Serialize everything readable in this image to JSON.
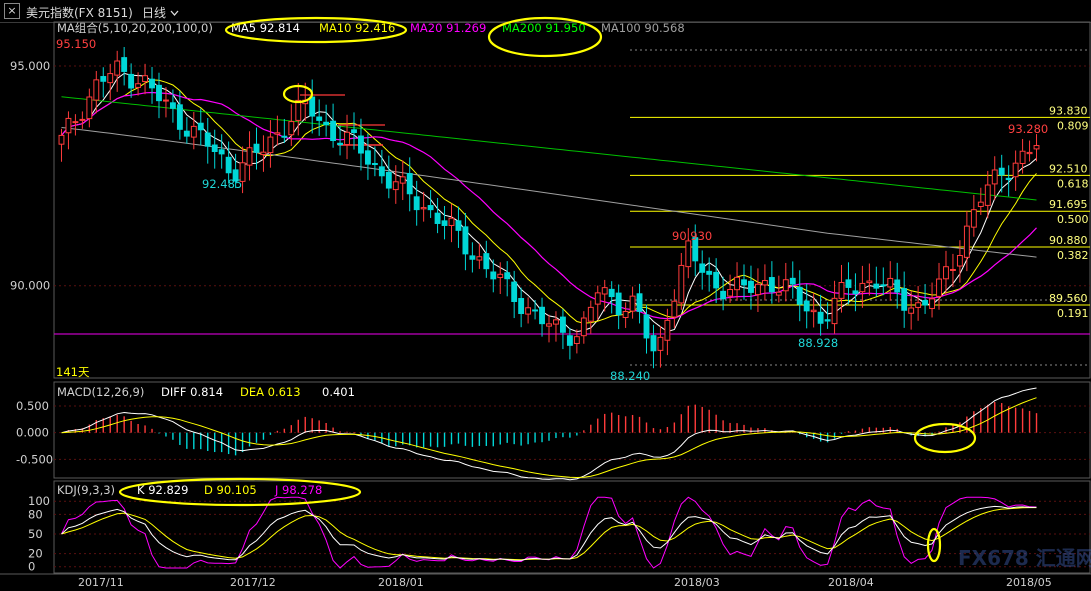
{
  "window": {
    "close_label": "×",
    "title": "美元指数(FX 8151)",
    "period": "日线",
    "period_icon": "chevron-down-icon"
  },
  "colors": {
    "bg": "#000000",
    "up": "#ff3b3b",
    "down": "#00d7d7",
    "ma5": "#ffffff",
    "ma10": "#ffff00",
    "ma20": "#ff00ff",
    "ma200": "#00c000",
    "ma100": "#a0a0a0",
    "fib": "#ffff00",
    "support": "#c000c0",
    "highlight": "#ffff00",
    "kdj_k": "#ffffff",
    "kdj_d": "#ffff00",
    "kdj_j": "#ff00ff"
  },
  "main_legend": {
    "prefix": "MA组合(5,10,20,200,100,0)",
    "ma5": "MA5 92.814",
    "ma10": "MA10 92.416",
    "ma20": "MA20 91.269",
    "ma200": "MA200 91.950",
    "ma100": "MA100 90.568"
  },
  "price_annotations": {
    "top_high": "95.150",
    "low_dec": "92.485",
    "swing_high": "90.930",
    "low_feb": "88.240",
    "low_apr": "88.928",
    "last_high": "93.280",
    "days": "141天"
  },
  "fib_levels": [
    {
      "price": "93.830",
      "ratio": "0.809"
    },
    {
      "price": "92.510",
      "ratio": "0.618"
    },
    {
      "price": "91.695",
      "ratio": "0.500"
    },
    {
      "price": "90.880",
      "ratio": "0.382"
    },
    {
      "price": "89.560",
      "ratio": "0.191"
    }
  ],
  "macd_legend": {
    "prefix": "MACD(12,26,9)",
    "diff": "DIFF 0.814",
    "dea": "DEA 0.613",
    "macd": "0.401"
  },
  "kdj_legend": {
    "prefix": "KDJ(9,3,3)",
    "k": "K 92.829",
    "d": "D 90.105",
    "j": "J 98.278"
  },
  "watermark": "FX678 汇通网",
  "chart_data": [
    {
      "type": "candlestick",
      "x": [
        "2017/11",
        "2017/12",
        "2018/01",
        "2018/03",
        "2018/04",
        "2018/05"
      ],
      "y_ticks": [
        95.0,
        90.0
      ],
      "y_tick_labels": [
        "95.000",
        "90.000"
      ],
      "ylim": [
        87.9,
        96.0
      ],
      "annotations": [
        95.15,
        92.485,
        90.93,
        88.24,
        88.928,
        93.28
      ],
      "fib_levels": [
        93.83,
        92.51,
        91.695,
        90.88,
        89.56
      ],
      "fib_ratios": [
        0.809,
        0.618,
        0.5,
        0.382,
        0.191
      ],
      "ma_values": {
        "MA5": 92.814,
        "MA10": 92.416,
        "MA20": 91.269,
        "MA200": 91.95,
        "MA100": 90.568
      }
    },
    {
      "type": "bar",
      "name": "MACD(12,26,9)",
      "y_ticks": [
        0.5,
        0.0,
        -0.5
      ],
      "y_tick_labels": [
        "0.500",
        "0.000",
        "-0.500"
      ],
      "values": {
        "DIFF": 0.814,
        "DEA": 0.613,
        "MACD": 0.401
      }
    },
    {
      "type": "line",
      "name": "KDJ(9,3,3)",
      "y_ticks": [
        100,
        80,
        50,
        20,
        0
      ],
      "y_tick_labels": [
        "100",
        "80",
        "50",
        "20",
        "0"
      ],
      "values": {
        "K": 92.829,
        "D": 90.105,
        "J": 98.278
      }
    }
  ]
}
